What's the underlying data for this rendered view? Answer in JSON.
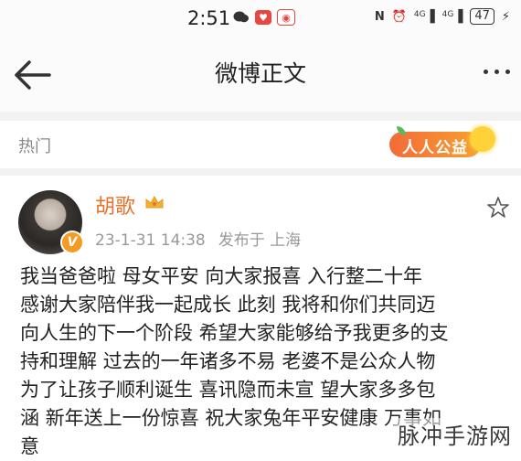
{
  "status_bar": {
    "time": "2:51",
    "network_1": "4G",
    "network_2": "4G",
    "battery": "47"
  },
  "nav": {
    "title": "微博正文"
  },
  "hot": {
    "label": "热门",
    "badge_text": "人人公益"
  },
  "post": {
    "author": "胡歌",
    "date": "23-1-31 14:38",
    "location": "发布于 上海",
    "verified_mark": "V",
    "content_lines": [
      "我当爸爸啦 母女平安 向大家报喜 入行整二十年",
      "感谢大家陪伴我一起成长 此刻 我将和你们共同迈",
      "向人生的下一个阶段 希望大家能够给予我更多的支",
      "持和理解 过去的一年诸多不易 老婆不是公众人物",
      "为了让孩子顺利诞生 喜讯隐而未宣 望大家多多包",
      "涵 新年送上一份惊喜 祝大家兔年平安健康 万事如",
      "意"
    ]
  },
  "watermark": "脉冲手游网",
  "colors": {
    "author": "#e8722a",
    "badge_gradient_start": "#f36b3a",
    "badge_gradient_end": "#f7a12d",
    "verified": "#f59a23"
  }
}
